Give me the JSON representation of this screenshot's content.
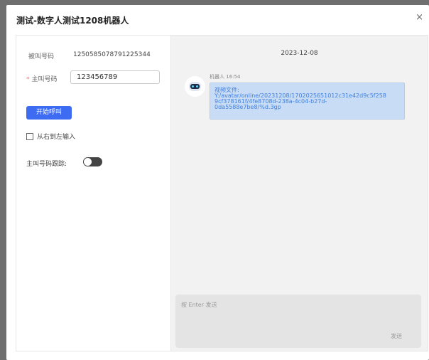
{
  "dialog": {
    "title": "测试-数字人测试1208机器人",
    "close_glyph": "×"
  },
  "form": {
    "called_label": "被叫号码",
    "called_value": "1250585078791225344",
    "caller_required_mark": "*",
    "caller_label": "主叫号码",
    "caller_value": "123456789",
    "call_button_label": "开始呼叫",
    "rtl_checkbox_label": "从右到左输入",
    "rtl_checked": false,
    "track_label": "主叫号码跟踪:",
    "track_enabled": false
  },
  "chat": {
    "date": "2023-12-08",
    "messages": [
      {
        "sender": "机器人",
        "time": "16:54",
        "avatar_icon": "robot-icon",
        "lines": [
          "视频文件:",
          "Y:/avatar/online/20231208/1702025651012c31e42d9c5f258",
          "9cf378161f/4fe8708d-238a-4c04-b27d-",
          "0da5588e7be8/%d.3gp"
        ]
      }
    ],
    "input_placeholder": "按 Enter 发送",
    "send_label": "发送"
  },
  "colors": {
    "primary": "#3d6bf2",
    "bubble_bg": "#c9dcf5",
    "bubble_text": "#3f80e0",
    "required": "#f56c6c"
  }
}
